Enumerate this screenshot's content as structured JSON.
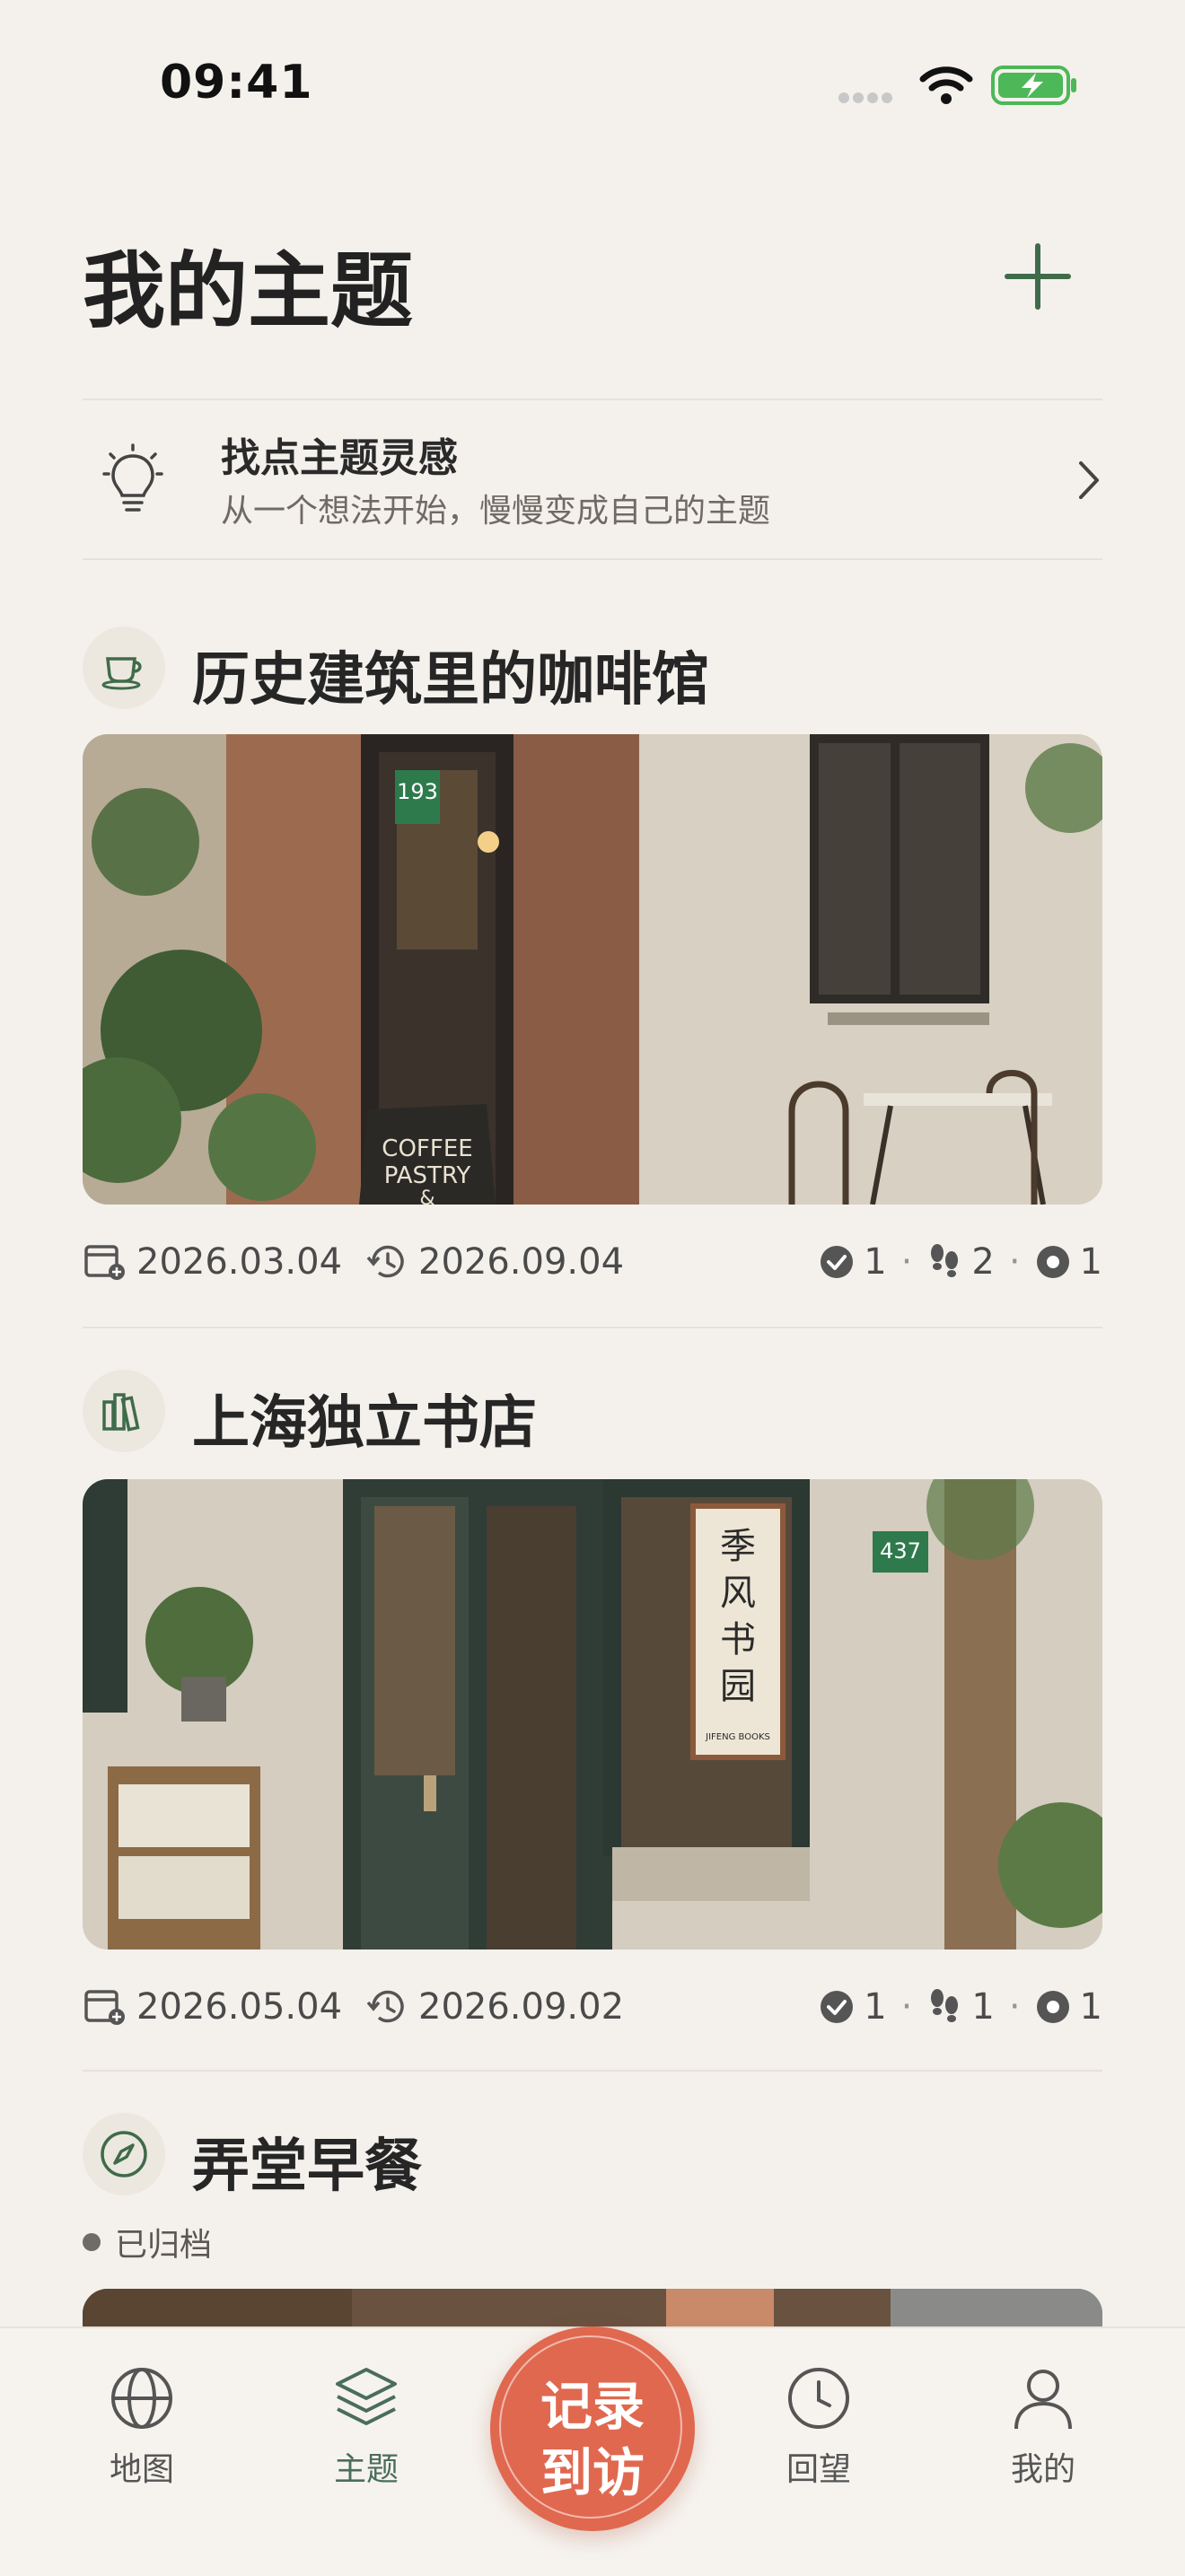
{
  "status_bar": {
    "time": "09:41"
  },
  "header": {
    "title": "我的主题"
  },
  "inspiration": {
    "title": "找点主题灵感",
    "subtitle": "从一个想法开始，慢慢变成自己的主题"
  },
  "themes": [
    {
      "title": "历史建筑里的咖啡馆",
      "icon": "coffee-cup-icon",
      "photo_signs": [
        "193",
        "COFFEE",
        "PASTRY",
        "&"
      ],
      "created": "2026.03.04",
      "updated": "2026.09.04",
      "visited": "1",
      "footprints": "2",
      "planned": "1"
    },
    {
      "title": "上海独立书店",
      "icon": "books-icon",
      "photo_signs": [
        "437",
        "季风书园",
        "JIFENG BOOKS"
      ],
      "created": "2026.05.04",
      "updated": "2026.09.02",
      "visited": "1",
      "footprints": "1",
      "planned": "1"
    },
    {
      "title": "弄堂早餐",
      "icon": "compass-icon",
      "status": "已归档"
    }
  ],
  "tabbar": {
    "map": "地图",
    "themes": "主题",
    "record_line1": "记录",
    "record_line2": "到访",
    "review": "回望",
    "me": "我的"
  },
  "colors": {
    "background": "#f4f1ec",
    "accent_green": "#3f6b4a",
    "record_button": "#e0684f"
  }
}
